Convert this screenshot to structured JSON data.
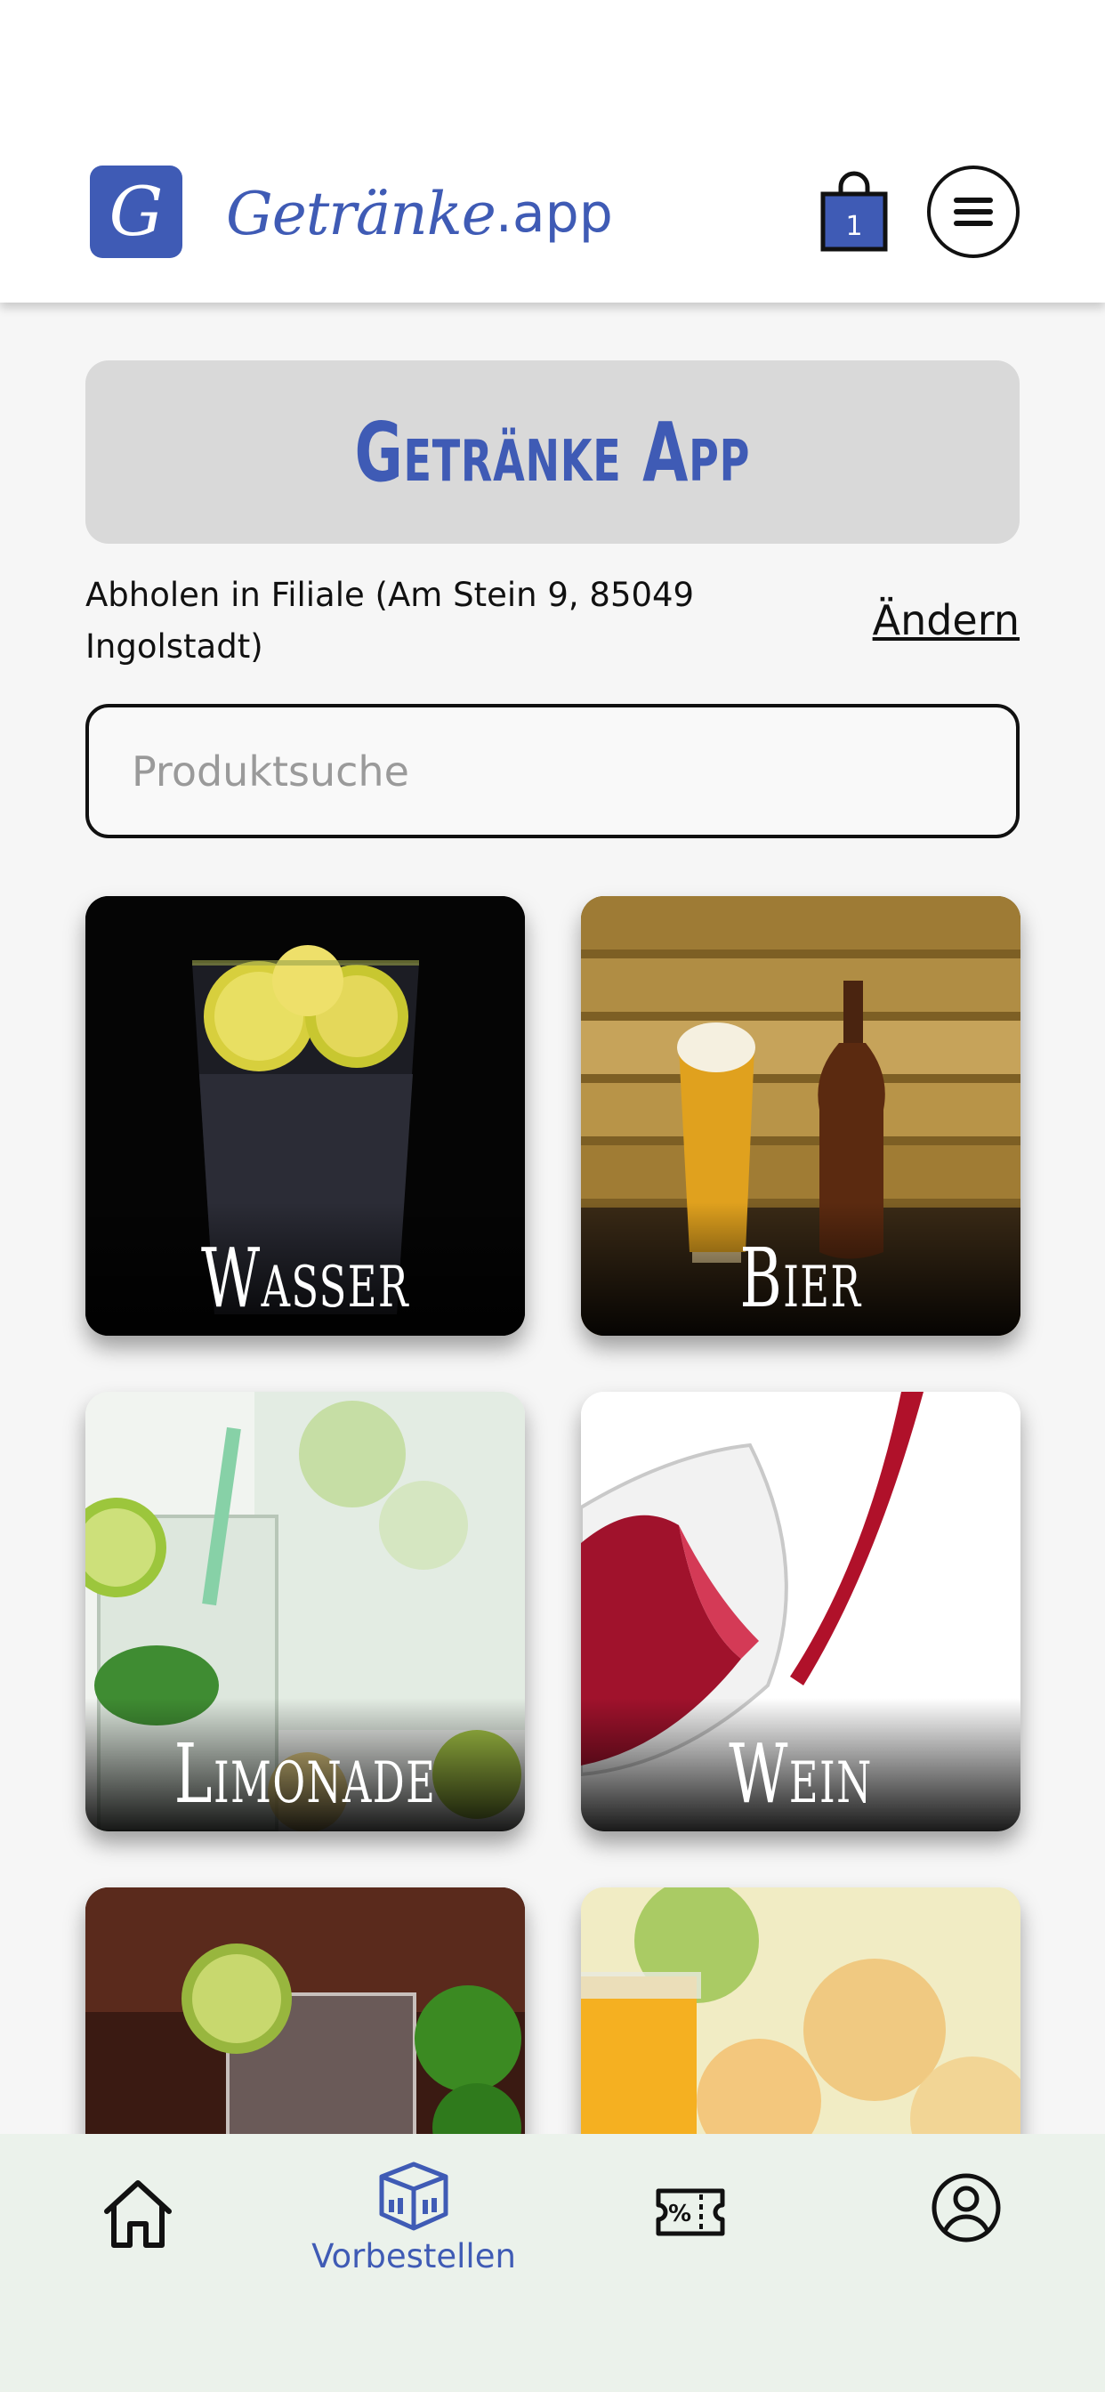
{
  "header": {
    "logo_letter": "G",
    "brand_script": "Getränke",
    "brand_suffix": ".app",
    "cart_count": "1"
  },
  "banner": {
    "title": "Getränke App"
  },
  "pickup": {
    "text": "Abholen in Filiale (Am Stein 9, 85049 Ingolstadt)",
    "change_label": "Ändern"
  },
  "search": {
    "placeholder": "Produktsuche",
    "value": ""
  },
  "categories": [
    {
      "label": "Wasser"
    },
    {
      "label": "Bier"
    },
    {
      "label": "Limonade"
    },
    {
      "label": "Wein"
    },
    {
      "label": ""
    },
    {
      "label": ""
    }
  ],
  "bottom_nav": {
    "items": [
      {
        "icon": "home-icon",
        "label": ""
      },
      {
        "icon": "box-icon",
        "label": "Vorbestellen",
        "active": true
      },
      {
        "icon": "discount-ticket-icon",
        "label": ""
      },
      {
        "icon": "user-profile-icon",
        "label": ""
      }
    ]
  },
  "colors": {
    "brand": "#3f5bb5",
    "nav_bg": "#ebf2eb",
    "banner_bg": "#d9d9d9"
  }
}
